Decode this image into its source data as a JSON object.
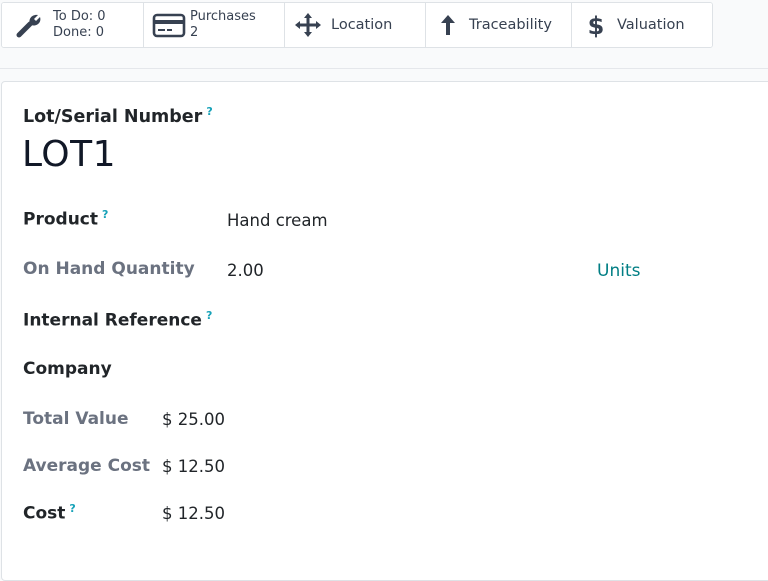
{
  "smart_buttons": {
    "todo": {
      "line1": "To Do: 0",
      "line2": "Done: 0",
      "icon": "wrench-icon"
    },
    "purchases": {
      "label": "Purchases",
      "count": "2",
      "icon": "credit-card-icon"
    },
    "location": {
      "label": "Location",
      "icon": "arrows-move-icon"
    },
    "traceability": {
      "label": "Traceability",
      "icon": "arrow-up-icon"
    },
    "valuation": {
      "label": "Valuation",
      "icon": "dollar-icon"
    }
  },
  "form": {
    "lot_label": "Lot/Serial Number",
    "lot_name": "LOT1",
    "help_mark": "?",
    "fields": {
      "product": {
        "label": "Product",
        "value": "Hand cream"
      },
      "on_hand": {
        "label": "On Hand Quantity",
        "value": "2.00",
        "uom": "Units"
      },
      "internal_ref": {
        "label": "Internal Reference",
        "value": ""
      },
      "company": {
        "label": "Company",
        "value": ""
      },
      "total_value": {
        "label": "Total Value",
        "value": "$ 25.00"
      },
      "average_cost": {
        "label": "Average Cost",
        "value": "$ 12.50"
      },
      "cost": {
        "label": "Cost",
        "value": "$ 12.50"
      }
    }
  },
  "colors": {
    "link": "#017e84",
    "help": "#17a2b8",
    "muted_label": "#6b7280"
  }
}
